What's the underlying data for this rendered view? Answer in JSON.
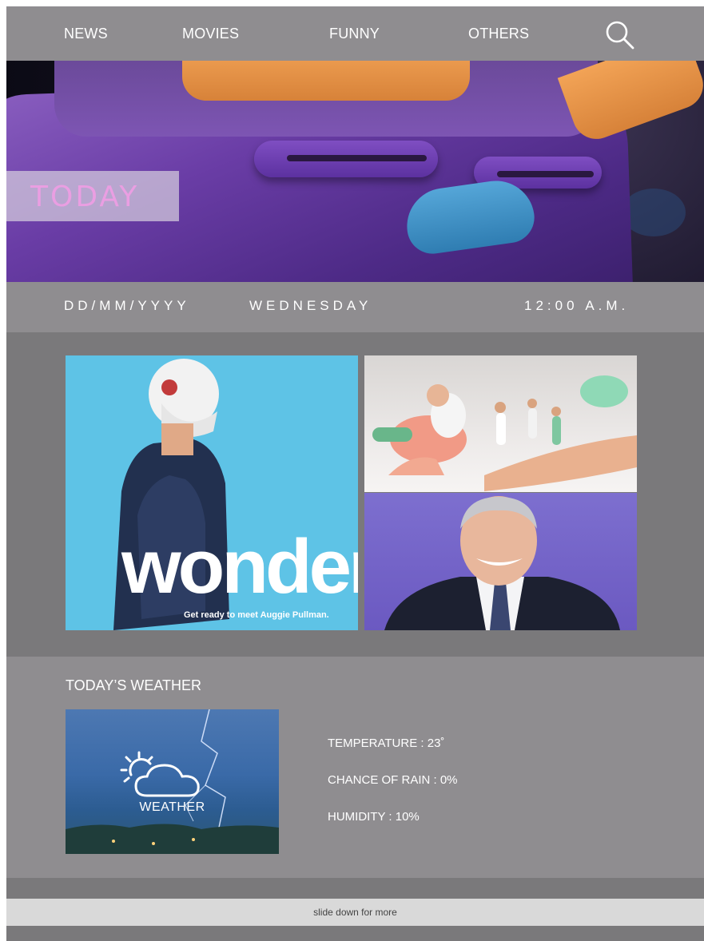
{
  "nav": {
    "items": [
      {
        "label": "NEWS"
      },
      {
        "label": "MOVIES"
      },
      {
        "label": "FUNNY"
      },
      {
        "label": "OTHERS"
      }
    ],
    "search_icon": "search-icon"
  },
  "hero": {
    "label": "TODAY"
  },
  "datebar": {
    "date": "DD/MM/YYYY",
    "day": "WEDNESDAY",
    "time": "12:00 A.M."
  },
  "gallery": {
    "wonder_title": "wonder",
    "wonder_tagline": "Get ready to meet Auggie Pullman."
  },
  "weather": {
    "title": "TODAY’S WEATHER",
    "card_label": "WEATHER",
    "stats": [
      {
        "text": "TEMPERATURE : 23˚"
      },
      {
        "text": "CHANCE OF RAIN : 0%"
      },
      {
        "text": "HUMIDITY : 10%"
      }
    ]
  },
  "footer": {
    "slide_text": "slide down for more"
  }
}
